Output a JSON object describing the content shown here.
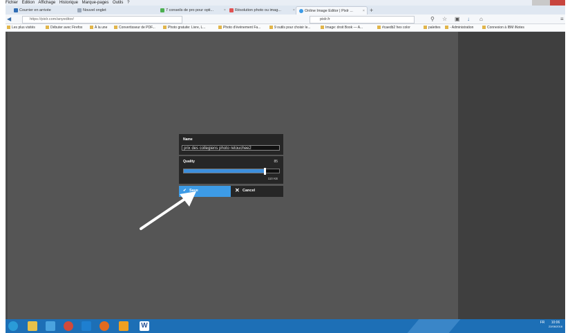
{
  "menu": [
    "Fichier",
    "Édition",
    "Affichage",
    "Historique",
    "Marque-pages",
    "Outils",
    "?"
  ],
  "tabs": [
    {
      "label": "Courrier en arrivée",
      "active": false
    },
    {
      "label": "Nouvel onglet",
      "active": false
    },
    {
      "label": "7 conseils de pro pour opti...",
      "active": false
    },
    {
      "label": "Résolution photo ou imag...",
      "active": false
    },
    {
      "label": "Online Image Editor | Pixlr ...",
      "active": true
    }
  ],
  "nav": {
    "url": "https://pixlr.com/anyeditor/",
    "search": "pixlr.fr"
  },
  "bookmarks": [
    "Les plus visités",
    "Débuter avec Firefox",
    "À la une",
    "Convertisseur de PDF...",
    "Photo gratuite: Livre, L...",
    "Photo d'événement Fa...",
    "9 outils pour choisir le...",
    "Image: droit Book — A...",
    "#caedb2 hex color",
    "palettes",
    "- Administration",
    "Connexion à IBM iNotes"
  ],
  "dialog": {
    "name_label": "Name",
    "name_value": "prix des collegiens photo retouchee2",
    "quality_label": "Quality",
    "quality_value": "85",
    "quality_fraction": 0.85,
    "file_size": "110 KB",
    "save_label": "Save",
    "cancel_label": "Cancel"
  },
  "taskbar": {
    "language": "FR",
    "time": "10:06",
    "date": "22/06/2018"
  },
  "colors": {
    "accent": "#3d9be6",
    "canvas": "#555555",
    "taskbar": "#1d6fb6"
  }
}
